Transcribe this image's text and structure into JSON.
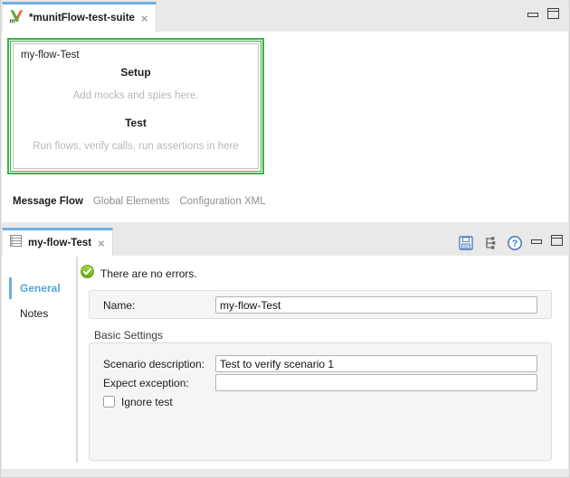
{
  "colors": {
    "accent_blue": "#6fb1e2",
    "selection_green": "#3caf4a",
    "sidebar_active_blue": "#55a7d8"
  },
  "top_panel": {
    "tab_title": "*munitFlow-test-suite",
    "close_glyph": "×",
    "canvas": {
      "flow_title": "my-flow-Test",
      "setup_label": "Setup",
      "setup_hint": "Add mocks and spies here.",
      "test_label": "Test",
      "test_hint": "Run flows, verify calls, run assertions in here"
    },
    "view_tabs": [
      {
        "label": "Message Flow"
      },
      {
        "label": "Global Elements"
      },
      {
        "label": "Configuration XML"
      }
    ]
  },
  "bottom_panel": {
    "tab_title": "my-flow-Test",
    "close_glyph": "×",
    "status_message": "There are no errors.",
    "sidebar": [
      {
        "label": "General"
      },
      {
        "label": "Notes"
      }
    ],
    "form": {
      "name_label": "Name:",
      "name_value": "my-flow-Test",
      "section_title": "Basic Settings",
      "scenario_label": "Scenario description:",
      "scenario_value": "Test to verify scenario 1",
      "exception_label": "Expect exception:",
      "exception_value": "",
      "ignore_label": "Ignore test",
      "ignore_checked": false
    }
  }
}
